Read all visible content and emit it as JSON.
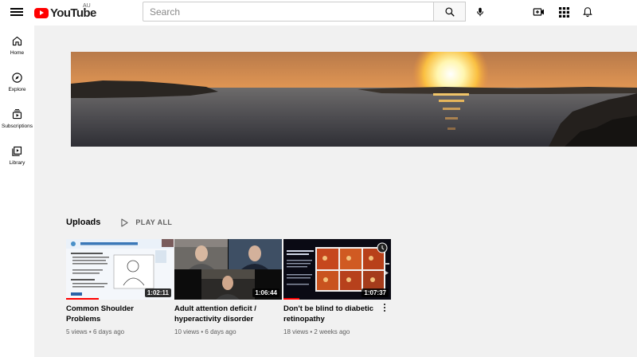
{
  "header": {
    "logo_text": "YouTube",
    "country_code": "AU",
    "search": {
      "placeholder": "Search",
      "value": ""
    }
  },
  "sidebar": {
    "items": [
      {
        "label": "Home",
        "icon": "home-icon"
      },
      {
        "label": "Explore",
        "icon": "compass-icon"
      },
      {
        "label": "Subscriptions",
        "icon": "subscriptions-icon"
      },
      {
        "label": "Library",
        "icon": "library-icon"
      }
    ]
  },
  "uploads": {
    "title": "Uploads",
    "play_all_label": "PLAY ALL",
    "videos": [
      {
        "title": "Common Shoulder Problems",
        "duration": "1:02:11",
        "views": "5 views",
        "age": "6 days ago",
        "progress": 0.3
      },
      {
        "title": "Adult attention deficit / hyperactivity disorder",
        "duration": "1:06:44",
        "views": "10 views",
        "age": "6 days ago",
        "progress": 0.0
      },
      {
        "title": "Don't be blind to diabetic retinopathy",
        "duration": "1:07:37",
        "views": "18 views",
        "age": "2 weeks ago",
        "progress": 0.15
      }
    ]
  },
  "colors": {
    "brand_red": "#ff0000",
    "background": "#f1f1f1",
    "meta_text": "#606060"
  }
}
